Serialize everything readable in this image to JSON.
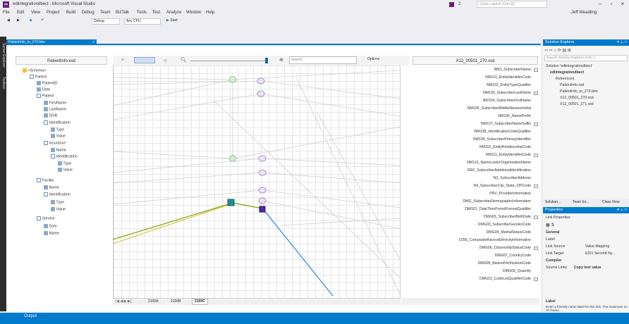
{
  "window": {
    "title": "edlintegrationdbect - Microsoft Visual Studio",
    "notify_count": "2",
    "quick_launch": "Quick Launch (Ctrl+Q)",
    "user": "Jeff Weadling"
  },
  "menu": [
    "File",
    "Edit",
    "View",
    "Project",
    "Build",
    "Debug",
    "Team",
    "BizTalk",
    "Tools",
    "Test",
    "Analyze",
    "Window",
    "Help"
  ],
  "toolbar": {
    "config": "Debug",
    "platform": "Any CPU",
    "start": "Start"
  },
  "left_strip": [
    "Server Explorer",
    "Toolbox"
  ],
  "doc_tab": {
    "label": "PatientInfo_to_270.btm",
    "close": "×"
  },
  "mapper": {
    "source_header": "PatientInfo.xsd",
    "target_header": "X12_00501_270.xsd",
    "search_placeholder": "Search",
    "options": "Options"
  },
  "source_tree": [
    "<Schema>",
    "Patient",
    "PatientID",
    "Date",
    "Patient",
    "FirstName",
    "LastName",
    "DOB",
    "Identification",
    "Type",
    "Value",
    "Insurance",
    "Name",
    "Identification",
    "Type",
    "Value",
    "Facility",
    "Name",
    "Identification",
    "Type",
    "Value",
    "Service",
    "Date",
    "Name"
  ],
  "target_list": [
    "NM1_SubscriberName",
    "NM101_EntityIdentifierCode",
    "NM102_EntityTypeQualifier",
    "NM103_SubscriberLastName",
    "NM104_SubscriberFirstName",
    "NM105_SubscriberMiddleNameorInitial",
    "NM106_NamePrefix",
    "NM107_SubscriberNameSuffix",
    "NM108_IdentificationCodeQualifier",
    "NM109_SubscriberPrimaryIdentifier",
    "NM110_EntityRelationshipCode",
    "NM111_EntityIdentifierCode",
    "NM112_NameLastorOrganizationName",
    "REF_SubscriberAdditionalIdentification",
    "N3_SubscriberAddress",
    "N4_SubscriberCity_State_ZIPCode",
    "PRV_ProviderInformation",
    "DMG_SubscriberDemographicInformation",
    "DMG01_DateTimePeriodFormatQualifier",
    "DMG02_SubscriberBirthDate",
    "DMG03_SubscriberGenderCode",
    "DMG04_MaritalStatusCode",
    "C056_CompositeRaceorEthnicityInformation",
    "DMG06_CitizenshipStatusCode",
    "DMG07_CountryCode",
    "DMG08_BasisofVerificationCode",
    "DMG09_Quantity",
    "DMG10_CodeListQualifierCode"
  ],
  "page_tabs": [
    "2100A",
    "2100B",
    "2100C"
  ],
  "solution_explorer": {
    "title": "Solution Explorer",
    "search": "Search Solution Explorer (Ctrl+;)",
    "items": [
      "Solution 'edlintegrationdbect'",
      "edlintegrationdbect",
      "References",
      "PatientInfo.xsd",
      "PatientInfo_to_270.btm",
      "X12_00501_270.xsd",
      "X12_00501_271.xsd"
    ]
  },
  "se_tabs": [
    "Solution...",
    "Team Ex...",
    "Class View"
  ],
  "properties": {
    "title": "Properties",
    "object": "Link Properties",
    "general": "General",
    "rows": [
      [
        "Label",
        ""
      ],
      [
        "Link Source",
        "Value Mapping"
      ],
      [
        "Link Target",
        "EDI1 Second Ny..."
      ]
    ],
    "compiler": "Compiler",
    "source_links": [
      "Source Links",
      "Copy text value"
    ],
    "desc_title": "Label",
    "desc": "Enter a friendly name label for this link. The maximum no of charac..."
  },
  "output": {
    "label": "Output"
  },
  "colors": {
    "accent": "#007acc",
    "vs_purple": "#68217a",
    "link_green": "#8aa000",
    "link_blue": "#3d8ee0"
  }
}
